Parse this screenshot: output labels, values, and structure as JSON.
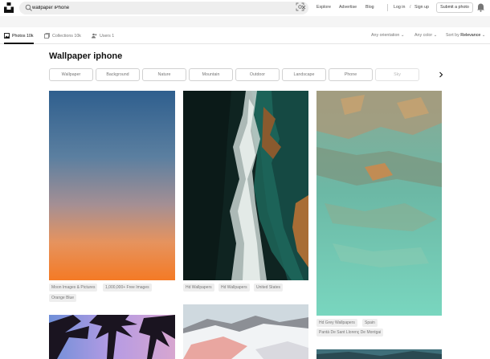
{
  "header": {
    "search": {
      "value": "wallpaper iPhone"
    },
    "nav": {
      "explore": "Explore",
      "advertise": "Advertise",
      "blog": "Blog"
    },
    "login": "Log in",
    "separator": "/",
    "signup": "Sign up",
    "submit": "Submit a photo"
  },
  "tabs": {
    "photos": "Photos 10k",
    "collections": "Collection​s 10k",
    "users": "Users 1"
  },
  "filters": {
    "orientation": "Any orientation",
    "color": "Any color",
    "sort_prefix": "Sort by",
    "sort_value": "Relevance"
  },
  "page": {
    "title": "Wallpaper iphone"
  },
  "chips": [
    "Wallpaper",
    "Background",
    "Nature",
    "Mountain",
    "Outdoor",
    "Landscape",
    "Phone",
    "Sky"
  ],
  "photos": {
    "col1": {
      "tags": [
        "Moon Images & Pictures",
        "1,000,000+ Free Images",
        "Orange Blue"
      ]
    },
    "col2": {
      "tags": [
        "Hd Wallpapers",
        "Hd Wallpapers",
        "United States"
      ]
    },
    "col3": {
      "tags": [
        "Hd Grey Wallpapers",
        "Spain",
        "Pantà De Sant Llorenç De Montgai"
      ]
    }
  },
  "icons": {
    "logo": "unsplash-logo",
    "search": "search-icon",
    "clear": "close-icon",
    "visual_search": "visual-search-icon",
    "notifications": "bell-icon",
    "photos_tab": "image-icon",
    "collections_tab": "collection-icon",
    "users_tab": "users-icon",
    "chips_next": "chevron-right-icon"
  }
}
